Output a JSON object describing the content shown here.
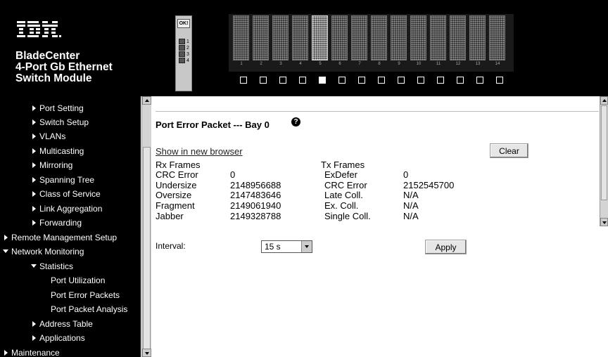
{
  "header": {
    "logo_text": "IBM.",
    "brand_lines": [
      "BladeCenter",
      "4-Port Gb Ethernet",
      "Switch Module"
    ],
    "module_ok_label": "OK!",
    "module_port_labels": [
      "1",
      "2",
      "3",
      "4"
    ],
    "bay_numbers": [
      "1",
      "2",
      "3",
      "4",
      "5",
      "6",
      "7",
      "8",
      "9",
      "10",
      "11",
      "12",
      "13",
      "14"
    ],
    "selected_bay": 5
  },
  "nav": {
    "items": [
      {
        "label": "Port Setting",
        "icon": "triangle-right-icon"
      },
      {
        "label": "Switch Setup",
        "icon": "triangle-right-icon"
      },
      {
        "label": "VLANs",
        "icon": "triangle-right-icon"
      },
      {
        "label": "Multicasting",
        "icon": "triangle-right-icon"
      },
      {
        "label": "Mirroring",
        "icon": "triangle-right-icon"
      },
      {
        "label": "Spanning Tree",
        "icon": "triangle-right-icon"
      },
      {
        "label": "Class of Service",
        "icon": "triangle-right-icon"
      },
      {
        "label": "Link Aggregation",
        "icon": "triangle-right-icon"
      },
      {
        "label": "Forwarding",
        "icon": "triangle-right-icon"
      },
      {
        "label": "Remote Management Setup",
        "icon": "triangle-right-icon"
      },
      {
        "label": "Network Monitoring",
        "icon": "triangle-down-icon"
      },
      {
        "label": "Statistics",
        "icon": "triangle-down-icon"
      },
      {
        "label": "Port Utilization",
        "icon": ""
      },
      {
        "label": "Port Error Packets",
        "icon": ""
      },
      {
        "label": "Port Packet Analysis",
        "icon": ""
      },
      {
        "label": "Address Table",
        "icon": "triangle-right-icon"
      },
      {
        "label": "Applications",
        "icon": "triangle-right-icon"
      },
      {
        "label": "Maintenance",
        "icon": "triangle-right-icon"
      }
    ]
  },
  "main": {
    "title": "Port Error Packet --- Bay 0",
    "help_icon": "?",
    "show_link": "Show in new browser",
    "clear_label": "Clear",
    "rx_header": "Rx Frames",
    "tx_header": "Tx Frames",
    "rx_rows": [
      {
        "label": "CRC Error",
        "value": "0"
      },
      {
        "label": "Undersize",
        "value": "2148956688"
      },
      {
        "label": "Oversize",
        "value": "2147483646"
      },
      {
        "label": "Fragment",
        "value": "2149061940"
      },
      {
        "label": "Jabber",
        "value": "2149328788"
      }
    ],
    "tx_rows": [
      {
        "label": "ExDefer",
        "value": "0"
      },
      {
        "label": "CRC Error",
        "value": "2152545700"
      },
      {
        "label": "Late Coll.",
        "value": "N/A"
      },
      {
        "label": "Ex. Coll.",
        "value": "N/A"
      },
      {
        "label": "Single Coll.",
        "value": "N/A"
      }
    ],
    "interval_label": "Interval:",
    "interval_value": "15 s",
    "apply_label": "Apply"
  }
}
